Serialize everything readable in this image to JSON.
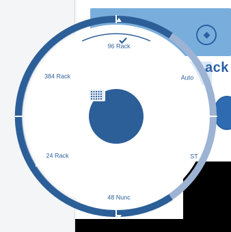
{
  "menu": {
    "top_item": "96 Rack",
    "top_right_item": "Auto",
    "right_item": "ST",
    "bottom_item": "48 Nunc",
    "left_item": "24 Rack",
    "top_left_item": "384 Rack",
    "selected_item": "96 Rack"
  },
  "center": {
    "icon": "grid-plate-icon"
  },
  "background": {
    "rack_text": "ack"
  },
  "colors": {
    "ring": "#2c5f98",
    "ring_light": "#9db3d3",
    "label": "#2f5f99",
    "center": "#2c5f98",
    "tile": "#79aedc"
  }
}
